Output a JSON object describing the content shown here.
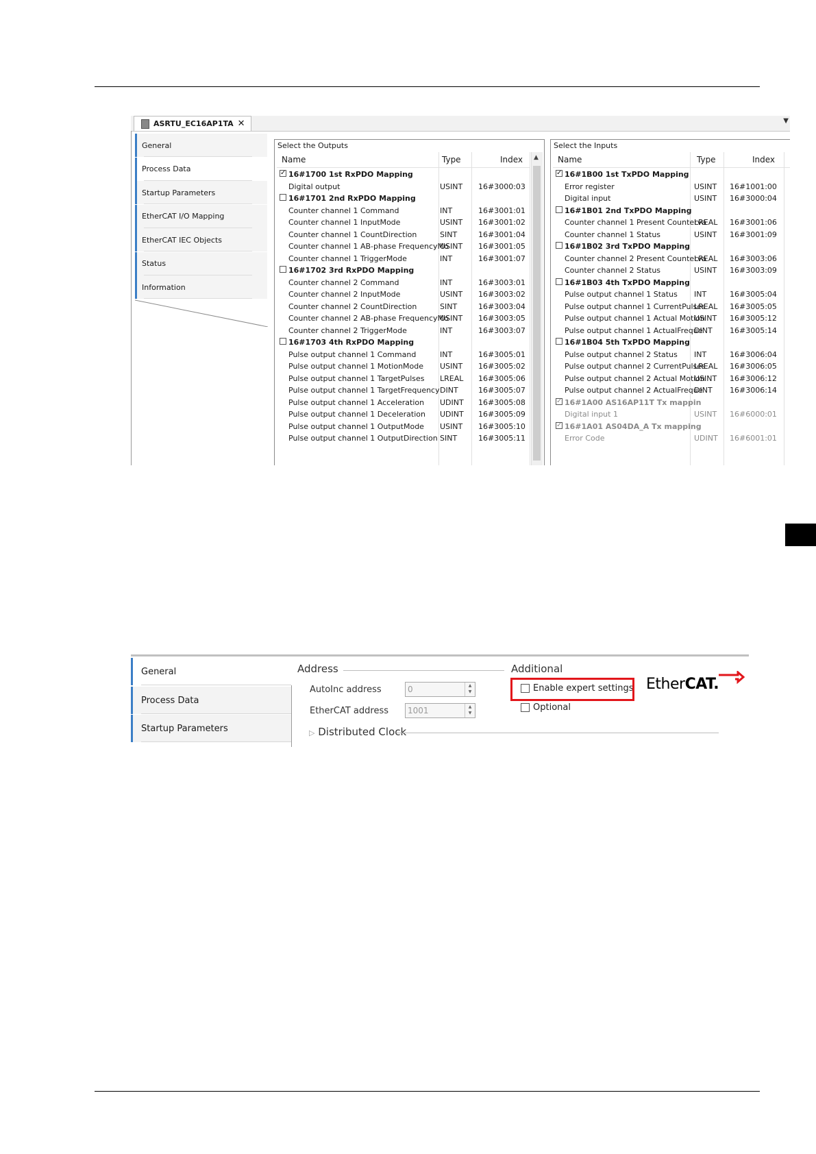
{
  "device_tab": "ASRTU_EC16AP1TA",
  "shot1": {
    "nav": [
      "General",
      "Process Data",
      "Startup Parameters",
      "EtherCAT I/O Mapping",
      "EtherCAT IEC Objects",
      "Status",
      "Information"
    ],
    "active_nav": "Process Data",
    "outputs": {
      "title": "Select the Outputs",
      "columns": [
        "Name",
        "Type",
        "Index"
      ],
      "rows": [
        {
          "name": "16#1700 1st RxPDO Mapping",
          "group": true,
          "checked": true
        },
        {
          "name": "Digital output",
          "type": "USINT",
          "index": "16#3000:03"
        },
        {
          "name": "16#1701 2nd RxPDO Mapping",
          "group": true,
          "checked": false
        },
        {
          "name": "Counter channel 1 Command",
          "type": "INT",
          "index": "16#3001:01"
        },
        {
          "name": "Counter channel 1 InputMode",
          "type": "USINT",
          "index": "16#3001:02"
        },
        {
          "name": "Counter channel 1 CountDirection",
          "type": "SINT",
          "index": "16#3001:04"
        },
        {
          "name": "Counter channel 1 AB-phase FrequencyMo",
          "type": "USINT",
          "index": "16#3001:05"
        },
        {
          "name": "Counter channel 1 TriggerMode",
          "type": "INT",
          "index": "16#3001:07"
        },
        {
          "name": "16#1702 3rd RxPDO Mapping",
          "group": true,
          "checked": false
        },
        {
          "name": "Counter channel 2 Command",
          "type": "INT",
          "index": "16#3003:01"
        },
        {
          "name": "Counter channel 2 InputMode",
          "type": "USINT",
          "index": "16#3003:02"
        },
        {
          "name": "Counter channel 2 CountDirection",
          "type": "SINT",
          "index": "16#3003:04"
        },
        {
          "name": "Counter channel 2 AB-phase FrequencyMo",
          "type": "USINT",
          "index": "16#3003:05"
        },
        {
          "name": "Counter channel 2 TriggerMode",
          "type": "INT",
          "index": "16#3003:07"
        },
        {
          "name": "16#1703 4th RxPDO Mapping",
          "group": true,
          "checked": false
        },
        {
          "name": "Pulse output channel 1 Command",
          "type": "INT",
          "index": "16#3005:01"
        },
        {
          "name": "Pulse output channel 1 MotionMode",
          "type": "USINT",
          "index": "16#3005:02"
        },
        {
          "name": "Pulse output channel 1 TargetPulses",
          "type": "LREAL",
          "index": "16#3005:06"
        },
        {
          "name": "Pulse output channel 1 TargetFrequency",
          "type": "DINT",
          "index": "16#3005:07"
        },
        {
          "name": "Pulse output channel 1 Acceleration",
          "type": "UDINT",
          "index": "16#3005:08"
        },
        {
          "name": "Pulse output channel 1 Deceleration",
          "type": "UDINT",
          "index": "16#3005:09"
        },
        {
          "name": "Pulse output channel 1 OutputMode",
          "type": "USINT",
          "index": "16#3005:10"
        },
        {
          "name": "Pulse output channel 1 OutputDirection",
          "type": "SINT",
          "index": "16#3005:11"
        }
      ]
    },
    "inputs": {
      "title": "Select the Inputs",
      "columns": [
        "Name",
        "Type",
        "Index"
      ],
      "rows": [
        {
          "name": "16#1B00 1st TxPDO Mapping",
          "group": true,
          "checked": true
        },
        {
          "name": "Error register",
          "type": "USINT",
          "index": "16#1001:00"
        },
        {
          "name": "Digital input",
          "type": "USINT",
          "index": "16#3000:04"
        },
        {
          "name": "16#1B01 2nd TxPDO Mapping",
          "group": true,
          "checked": false
        },
        {
          "name": "Counter channel 1 Present Counterva",
          "type": "LREAL",
          "index": "16#3001:06"
        },
        {
          "name": "Counter channel 1 Status",
          "type": "USINT",
          "index": "16#3001:09"
        },
        {
          "name": "16#1B02 3rd TxPDO Mapping",
          "group": true,
          "checked": false
        },
        {
          "name": "Counter channel 2 Present Counterva",
          "type": "LREAL",
          "index": "16#3003:06"
        },
        {
          "name": "Counter channel 2 Status",
          "type": "USINT",
          "index": "16#3003:09"
        },
        {
          "name": "16#1B03 4th TxPDO Mapping",
          "group": true,
          "checked": false
        },
        {
          "name": "Pulse output channel 1 Status",
          "type": "INT",
          "index": "16#3005:04"
        },
        {
          "name": "Pulse output channel 1 CurrentPulses",
          "type": "LREAL",
          "index": "16#3005:05"
        },
        {
          "name": "Pulse output channel 1 Actual Motion",
          "type": "USINT",
          "index": "16#3005:12"
        },
        {
          "name": "Pulse output channel 1 ActualFreque",
          "type": "DINT",
          "index": "16#3005:14"
        },
        {
          "name": "16#1B04 5th TxPDO Mapping",
          "group": true,
          "checked": false
        },
        {
          "name": "Pulse output channel 2 Status",
          "type": "INT",
          "index": "16#3006:04"
        },
        {
          "name": "Pulse output channel 2 CurrentPulses",
          "type": "LREAL",
          "index": "16#3006:05"
        },
        {
          "name": "Pulse output channel 2 Actual Motion",
          "type": "USINT",
          "index": "16#3006:12"
        },
        {
          "name": "Pulse output channel 2 ActualFreque",
          "type": "DINT",
          "index": "16#3006:14"
        },
        {
          "name": "16#1A00 AS16AP11T Tx mappin",
          "group": true,
          "checked": true,
          "gray": true
        },
        {
          "name": "Digital input 1",
          "type": "USINT",
          "index": "16#6000:01",
          "gray": true
        },
        {
          "name": "16#1A01 AS04DA_A Tx mapping",
          "group": true,
          "checked": true,
          "gray": true
        },
        {
          "name": "Error Code",
          "type": "UDINT",
          "index": "16#6001:01",
          "gray": true
        }
      ]
    }
  },
  "shot2": {
    "nav": [
      "General",
      "Process Data",
      "Startup Parameters"
    ],
    "address_legend": "Address",
    "autoinc_label": "AutoInc address",
    "autoinc_value": "0",
    "ethercat_label": "EtherCAT address",
    "ethercat_value": "1001",
    "additional_legend": "Additional",
    "enable_expert": "Enable expert settings",
    "optional": "Optional",
    "distributed_clock": "Distributed Clock",
    "logo_text_a": "Ether",
    "logo_text_b": "CAT."
  }
}
